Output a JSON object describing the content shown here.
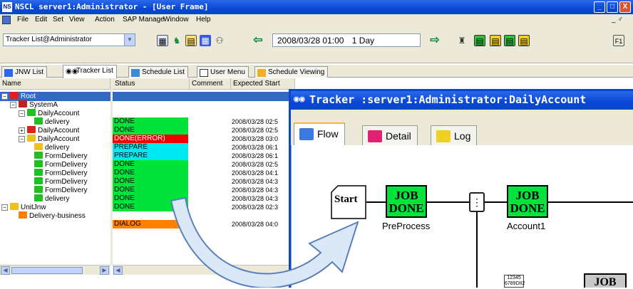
{
  "window": {
    "app_icon": "NS",
    "title": "NSCL server1:Administrator - [User Frame]",
    "controls": [
      "_",
      "□",
      "X"
    ]
  },
  "menu": [
    "File",
    "Edit",
    "Set",
    "View",
    "Action",
    "SAP Manage",
    "Window",
    "Help"
  ],
  "menu_right": "_ ♂",
  "toolbar": {
    "combo_value": "Tracker List@Administrator",
    "date_value": "2008/03/28 01:00",
    "range_value": "1 Day",
    "f1_label": "F1"
  },
  "tabs": [
    "JNW List",
    "Tracker List",
    "Schedule List",
    "User Menu",
    "Schedule Viewing"
  ],
  "columns": {
    "name": "Name",
    "status": "Status",
    "comment": "Comment",
    "start": "Expected Start"
  },
  "tree": [
    {
      "name": "Root",
      "status": "",
      "start": ""
    },
    {
      "name": "SystemA",
      "status": "",
      "start": ""
    },
    {
      "name": "DailyAccount",
      "status": "DONE",
      "start": "2008/03/28 02:5"
    },
    {
      "name": "delivery",
      "status": "DONE",
      "start": "2008/03/28 02:5"
    },
    {
      "name": "DailyAccount",
      "status": "DONE(ERROR)",
      "start": "2008/03/28 03:0"
    },
    {
      "name": "DailyAccount",
      "status": "PREPARE",
      "start": "2008/03/28 06:1"
    },
    {
      "name": "delivery",
      "status": "PREPARE",
      "start": "2008/03/28 06:1"
    },
    {
      "name": "FormDelivery",
      "status": "DONE",
      "start": "2008/03/28 02:5"
    },
    {
      "name": "FormDelivery",
      "status": "DONE",
      "start": "2008/03/28 04:1"
    },
    {
      "name": "FormDelivery",
      "status": "DONE",
      "start": "2008/03/28 04:3"
    },
    {
      "name": "FormDelivery",
      "status": "DONE",
      "start": "2008/03/28 04:3"
    },
    {
      "name": "FormDelivery",
      "status": "DONE",
      "start": "2008/03/28 04:3"
    },
    {
      "name": "delivery",
      "status": "DONE",
      "start": "2008/03/28 02:3"
    },
    {
      "name": "UnitJnw",
      "status": "",
      "start": ""
    },
    {
      "name": "Delivery-business",
      "status": "DIALOG",
      "start": "2008/03/28 04:0"
    }
  ],
  "status_colors": {
    "DONE": "#00e33a",
    "DONE(ERROR)": "#f00000",
    "PREPARE": "#00e8f0",
    "DIALOG": "#ff8000"
  },
  "tracker": {
    "title": "Tracker :server1:Administrator:DailyAccount",
    "tabs": [
      "Flow",
      "Detail",
      "Log"
    ],
    "start_label": "Start",
    "jobs": [
      {
        "line1": "JOB",
        "line2": "DONE",
        "label": "PreProcess"
      },
      {
        "line1": "JOB",
        "line2": "DONE",
        "label": "Account1"
      }
    ],
    "calendar_digits_1": "12345",
    "calendar_digits_2": "6789DII2",
    "partial_job_label": "JOB"
  }
}
